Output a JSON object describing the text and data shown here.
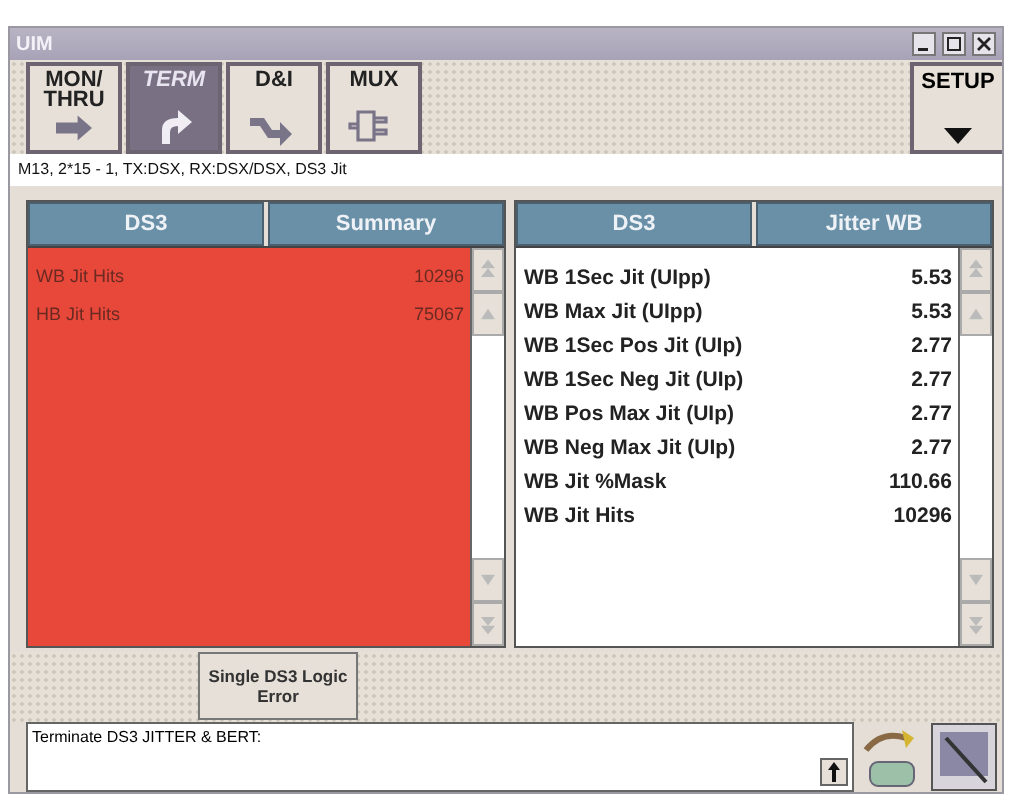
{
  "window": {
    "title": "UIM"
  },
  "toolbar": {
    "modes": [
      {
        "label": "MON/ THRU",
        "kind": "thru",
        "selected": false
      },
      {
        "label": "TERM",
        "kind": "term",
        "selected": true
      },
      {
        "label": "D&I",
        "kind": "dni",
        "selected": false
      },
      {
        "label": "MUX",
        "kind": "mux",
        "selected": false
      }
    ],
    "setup": "SETUP"
  },
  "status_line": "M13, 2*15 - 1, TX:DSX, RX:DSX/DSX, DS3 Jit",
  "panels": [
    {
      "tabs": [
        "DS3",
        "Summary"
      ],
      "alarm": true,
      "rows": [
        {
          "label": "WB Jit Hits",
          "value": "10296"
        },
        {
          "label": "HB Jit Hits",
          "value": "75067"
        }
      ]
    },
    {
      "tabs": [
        "DS3",
        "Jitter WB"
      ],
      "alarm": false,
      "rows": [
        {
          "label": "WB 1Sec Jit (UIpp)",
          "value": "5.53"
        },
        {
          "label": "WB Max Jit (UIpp)",
          "value": "5.53"
        },
        {
          "label": "WB 1Sec Pos Jit (UIp)",
          "value": "2.77"
        },
        {
          "label": "WB 1Sec Neg Jit (UIp)",
          "value": "2.77"
        },
        {
          "label": "WB Pos Max Jit (UIp)",
          "value": "2.77"
        },
        {
          "label": "WB Neg Max Jit (UIp)",
          "value": "2.77"
        },
        {
          "label": "WB Jit %Mask",
          "value": "110.66"
        },
        {
          "label": "WB Jit Hits",
          "value": "10296"
        }
      ]
    }
  ],
  "action_button": "Single DS3 Logic Error",
  "message": "Terminate DS3 JITTER & BERT:"
}
